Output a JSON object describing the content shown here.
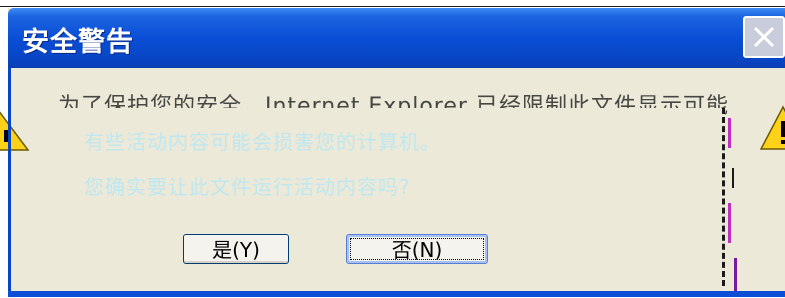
{
  "dialog": {
    "title": "安全警告",
    "message_line1": "为了保护您的安全，Internet Explorer 已经限制此文件显示可能访问您的计算机的活动内容。",
    "message_line2": "有些活动内容可能会损害您的计算机。",
    "question": "您确实要让此文件运行活动内容吗?",
    "buttons": {
      "yes": "是(Y)",
      "no": "否(N)"
    }
  },
  "icons": {
    "close": "close-icon",
    "warning_left": "warning-icon",
    "warning_right": "warning-icon"
  },
  "colors": {
    "titlebar": "#0a4ed6",
    "dialog_bg": "#ece9d8",
    "title_text": "#ffffff"
  }
}
